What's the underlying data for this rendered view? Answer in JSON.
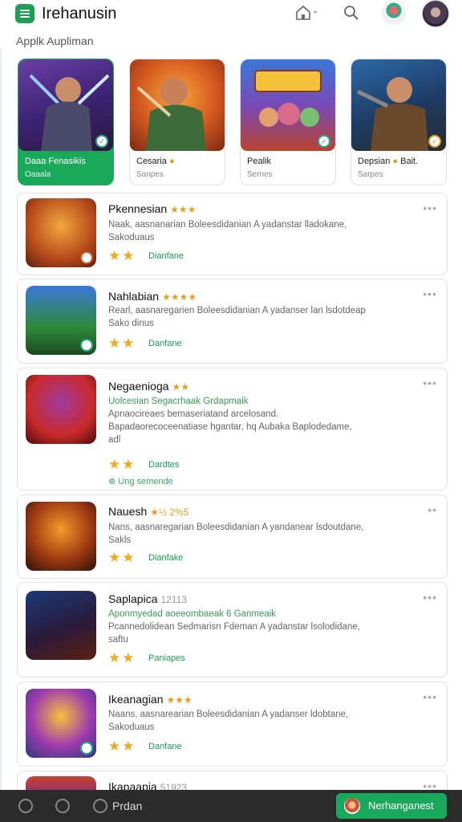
{
  "header": {
    "title": "Irehanusin",
    "subtitle": "Applk Aupliman",
    "icons": [
      "menu-icon",
      "home-icon",
      "search-icon"
    ]
  },
  "featured": [
    {
      "title": "Daaa Fenasikis",
      "sub": "Oaaala",
      "active": true
    },
    {
      "title": "Cesaria",
      "sub": "Sanpes",
      "active": false
    },
    {
      "title": "Pealik",
      "sub": "Sernes",
      "active": false
    },
    {
      "title": "Depsian",
      "title2": "Bait.",
      "sub": "Sarpes",
      "active": false
    }
  ],
  "list": [
    {
      "title": "Pkennesian",
      "rating": "★★★",
      "desc": "Naak, aasnanarian Boleesdidanian A yadanstar lladokane,\nSakoduaus",
      "tag": "Dianfane"
    },
    {
      "title": "Nahlabian",
      "rating": "★★★★",
      "desc": "Rearl, aasnaregarien Boleesdidanian A yadanser lan lsdotdeap\nSako dinus",
      "tag": "Danfane"
    },
    {
      "title": "Negaenioga",
      "rating": "★★",
      "desc": "Uolcesian Segacrhaak Grdapmaik\nApnaocireaes bemaseriatand arcelosand.\nBapadaorecoceenatiase hgantar, hq Aubaka Baplodedame,\nadl",
      "tag": "Dardtes",
      "extra": "⊕ Ung semende"
    },
    {
      "title": "Nauesh",
      "rating": "★½ 2%5",
      "desc": "Nans, aasnaregarian Boleesdidanian A yandanear lsdoutdane,\nSakls",
      "tag": "Dianfake"
    },
    {
      "title": "Saplapica",
      "rating": "12113",
      "desc": "Aponmyedad aoeeombaeak 6 Ganmeaik\nPcannedolidean Sedmarisn Fdeman A yadanstar lsolodidane,\nsaftu",
      "tag": "Paniapes"
    },
    {
      "title": "Ikeanagian",
      "rating": "★★★",
      "desc": "Naans, aasnarearian Boleesdidanian A yadanser ldobtane,\nSakoduaus",
      "tag": "Danfane"
    },
    {
      "title": "Ikapaapia",
      "rating": "51923",
      "desc": "",
      "tag": ""
    }
  ],
  "bottom_bar": {
    "label": "Prdan",
    "cta": "Nerhanganest"
  },
  "colors": {
    "accent": "#1aa85b",
    "star": "#f2a81c"
  }
}
